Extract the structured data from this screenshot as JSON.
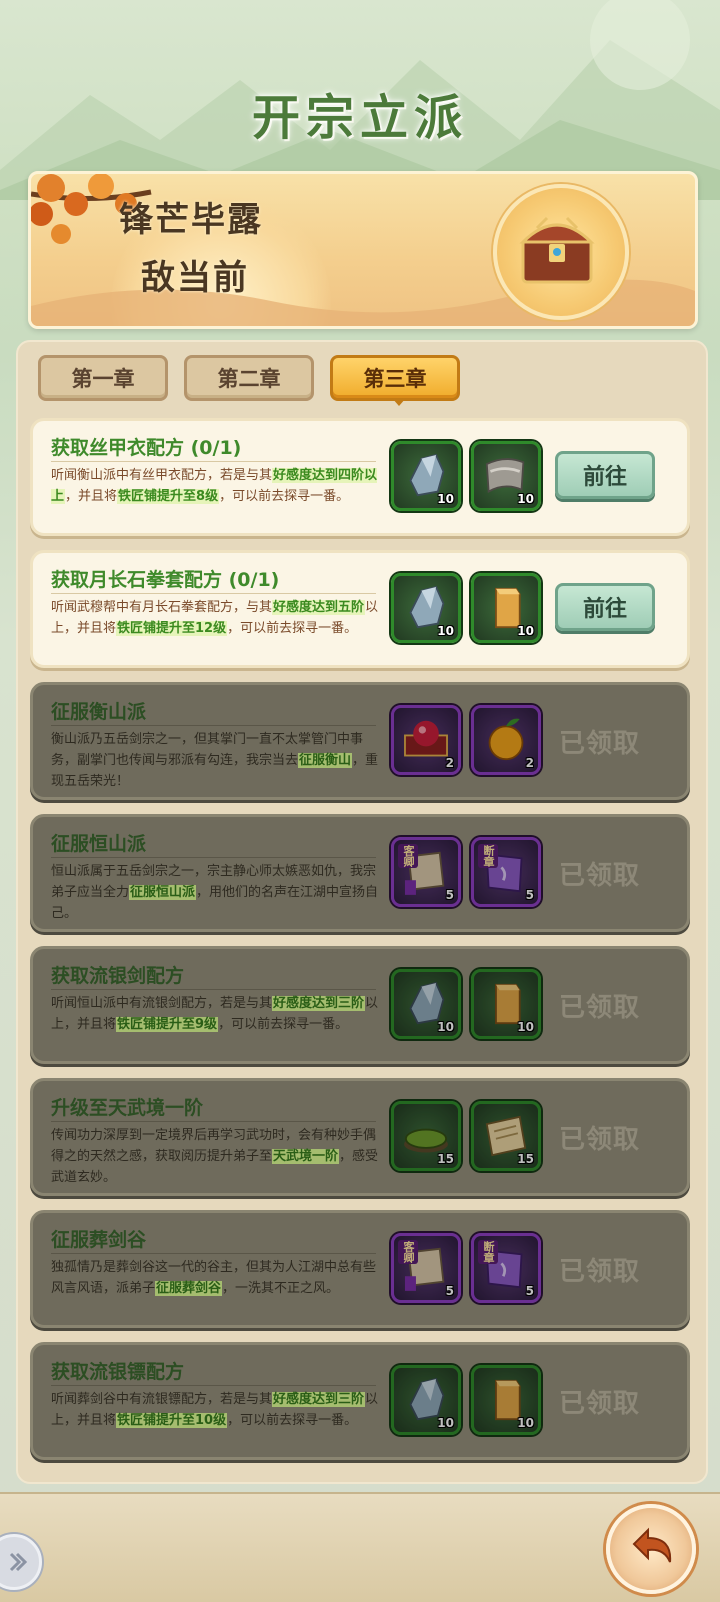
{
  "title": "开宗立派",
  "banner": {
    "line1": "锋芒毕露",
    "line2": "敌当前",
    "chest_icon": "treasure-chest-icon"
  },
  "tabs": [
    {
      "label": "第一章",
      "active": false
    },
    {
      "label": "第二章",
      "active": false
    },
    {
      "label": "第三章",
      "active": true
    }
  ],
  "quests": [
    {
      "title": "获取丝甲衣配方 (0/1)",
      "desc": [
        {
          "t": "听闻衡山派中有丝甲衣配方，若是与其"
        },
        {
          "t": "好感度达到四阶以上",
          "hl": true
        },
        {
          "t": "，并且将"
        },
        {
          "t": "铁匠铺提升至8级",
          "hl": true
        },
        {
          "t": "，可以前去探寻一番。"
        }
      ],
      "rewards": [
        {
          "icon": "ore-stone-icon",
          "count": "10",
          "rarity": "green"
        },
        {
          "icon": "silk-cloth-icon",
          "count": "10",
          "rarity": "green"
        }
      ],
      "status": "active",
      "button": "前往"
    },
    {
      "title": "获取月长石拳套配方 (0/1)",
      "desc": [
        {
          "t": "听闻武穆帮中有月长石拳套配方，与其"
        },
        {
          "t": "好感度达到五阶",
          "hl": true
        },
        {
          "t": "以上，并且将"
        },
        {
          "t": "铁匠铺提升至12级",
          "hl": true
        },
        {
          "t": "，可以前去探寻一番。"
        }
      ],
      "rewards": [
        {
          "icon": "ore-stone-icon",
          "count": "10",
          "rarity": "green"
        },
        {
          "icon": "wood-block-icon",
          "count": "10",
          "rarity": "green"
        }
      ],
      "status": "active",
      "button": "前往"
    },
    {
      "title": "征服衡山派",
      "desc": [
        {
          "t": "衡山派乃五岳剑宗之一，但其掌门一直不太掌管门中事务，副掌门也传闻与邪派有勾连，我宗当去"
        },
        {
          "t": "征服衡山",
          "hl": true
        },
        {
          "t": "，重现五岳荣光！"
        }
      ],
      "rewards": [
        {
          "icon": "red-pearl-box-icon",
          "count": "2",
          "rarity": "purple"
        },
        {
          "icon": "golden-fruit-icon",
          "count": "2",
          "rarity": "purple"
        }
      ],
      "status": "claimed",
      "button": "已领取"
    },
    {
      "title": "征服恒山派",
      "desc": [
        {
          "t": "恒山派属于五岳剑宗之一，宗主静心师太嫉恶如仇，我宗弟子应当全力"
        },
        {
          "t": "征服恒山派",
          "hl": true
        },
        {
          "t": "，用他们的名声在江湖中宣扬自己。"
        }
      ],
      "rewards": [
        {
          "icon": "scroll-page-icon",
          "count": "5",
          "rarity": "purple",
          "tag": "客卿"
        },
        {
          "icon": "broken-book-icon",
          "count": "5",
          "rarity": "purple",
          "tag": "断章"
        }
      ],
      "status": "claimed",
      "button": "已领取"
    },
    {
      "title": "获取流银剑配方",
      "desc": [
        {
          "t": "听闻恒山派中有流银剑配方，若是与其"
        },
        {
          "t": "好感度达到三阶",
          "hl": true
        },
        {
          "t": "以上，并且将"
        },
        {
          "t": "铁匠铺提升至9级",
          "hl": true
        },
        {
          "t": "，可以前去探寻一番。"
        }
      ],
      "rewards": [
        {
          "icon": "ore-stone-icon",
          "count": "10",
          "rarity": "green"
        },
        {
          "icon": "wood-block-icon",
          "count": "10",
          "rarity": "green"
        }
      ],
      "status": "claimed",
      "button": "已领取"
    },
    {
      "title": "升级至天武境一阶",
      "desc": [
        {
          "t": "传闻功力深厚到一定境界后再学习武功时，会有种妙手偶得之的天然之感，获取阅历提升弟子至"
        },
        {
          "t": "天武境一阶",
          "hl": true
        },
        {
          "t": "，感受武道玄妙。"
        }
      ],
      "rewards": [
        {
          "icon": "herb-bowl-icon",
          "count": "15",
          "rarity": "green"
        },
        {
          "icon": "manual-book-icon",
          "count": "15",
          "rarity": "green"
        }
      ],
      "status": "claimed",
      "button": "已领取"
    },
    {
      "title": "征服葬剑谷",
      "desc": [
        {
          "t": "独孤情乃是葬剑谷这一代的谷主，但其为人江湖中总有些风言风语，派弟子"
        },
        {
          "t": "征服葬剑谷",
          "hl": true
        },
        {
          "t": "，一洗其不正之风。"
        }
      ],
      "rewards": [
        {
          "icon": "scroll-page-icon",
          "count": "5",
          "rarity": "purple",
          "tag": "客卿"
        },
        {
          "icon": "broken-book-icon",
          "count": "5",
          "rarity": "purple",
          "tag": "断章"
        }
      ],
      "status": "claimed",
      "button": "已领取"
    },
    {
      "title": "获取流银镖配方",
      "desc": [
        {
          "t": "听闻葬剑谷中有流银镖配方，若是与其"
        },
        {
          "t": "好感度达到三阶",
          "hl": true
        },
        {
          "t": "以上，并且将"
        },
        {
          "t": "铁匠铺提升至10级",
          "hl": true
        },
        {
          "t": "，可以前去探寻一番。"
        }
      ],
      "rewards": [
        {
          "icon": "ore-stone-icon",
          "count": "10",
          "rarity": "green"
        },
        {
          "icon": "wood-block-icon",
          "count": "10",
          "rarity": "green"
        }
      ],
      "status": "claimed",
      "button": "已领取"
    }
  ],
  "bottom": {
    "back_icon": "back-arrow-icon",
    "side_icon": "double-chevron-icon"
  },
  "colors": {
    "title_green": "#4c7a3a",
    "tab_active": "#f0ac2b",
    "highlight_green": "#3b8a1f",
    "rarity_green": "#2f8a2b",
    "rarity_purple": "#8d3ec2"
  }
}
